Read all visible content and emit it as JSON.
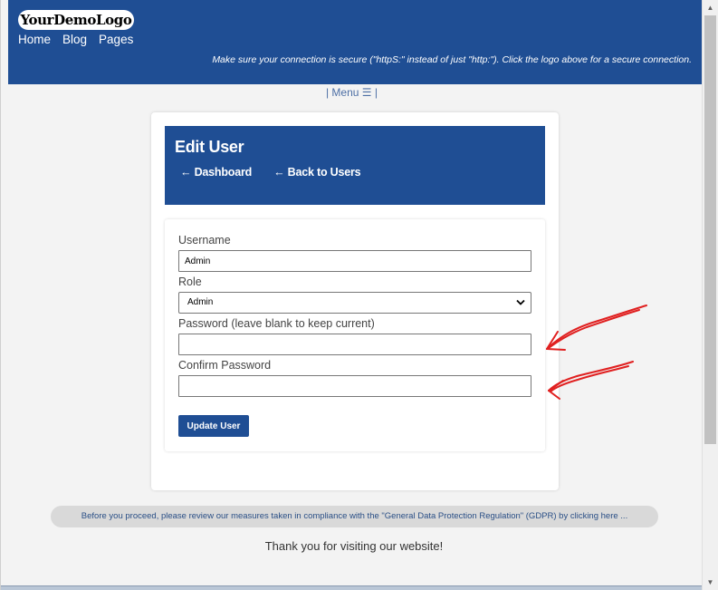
{
  "header": {
    "logo_text": "YourDemoLogo",
    "nav": [
      "Home",
      "Blog",
      "Pages"
    ],
    "secure_note": "Make sure your connection is secure (\"httpS:\" instead of just \"http:\"). Click the logo above for a secure connection."
  },
  "menu_toggle": "| Menu ☰ |",
  "card": {
    "title": "Edit User",
    "dashboard_link": "← Dashboard",
    "back_link": "← Back to Users"
  },
  "form": {
    "username_label": "Username",
    "username_value": "Admin",
    "role_label": "Role",
    "role_value": "Admin",
    "password_label": "Password (leave blank to keep current)",
    "password_value": "",
    "confirm_label": "Confirm Password",
    "confirm_value": "",
    "submit_label": "Update User"
  },
  "gdpr_text": "Before you proceed, please review our measures taken in compliance with the \"General Data Protection Regulation\" (GDPR) by clicking here ...",
  "thanks_text": "Thank you for visiting our website!",
  "scrollbar": {
    "up_glyph": "▲",
    "down_glyph": "▼"
  },
  "colors": {
    "brand_blue": "#1f4e94",
    "annotation_red": "#e02020",
    "page_bg": "#f3f3f3"
  },
  "icons": {
    "select_caret": "chevron-down-icon",
    "annotation": "red-arrow-icon"
  }
}
